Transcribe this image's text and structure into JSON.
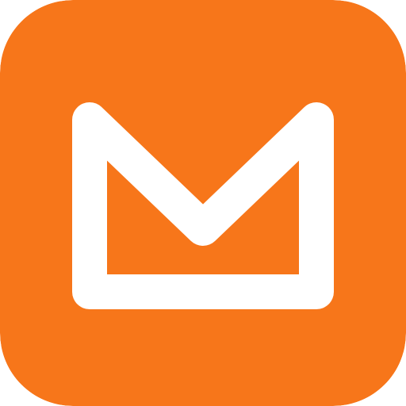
{
  "icon": {
    "name": "mail-app-icon",
    "depicts": "envelope-icon",
    "background_color": "#F7761A",
    "glyph_color": "#FFFFFF"
  }
}
